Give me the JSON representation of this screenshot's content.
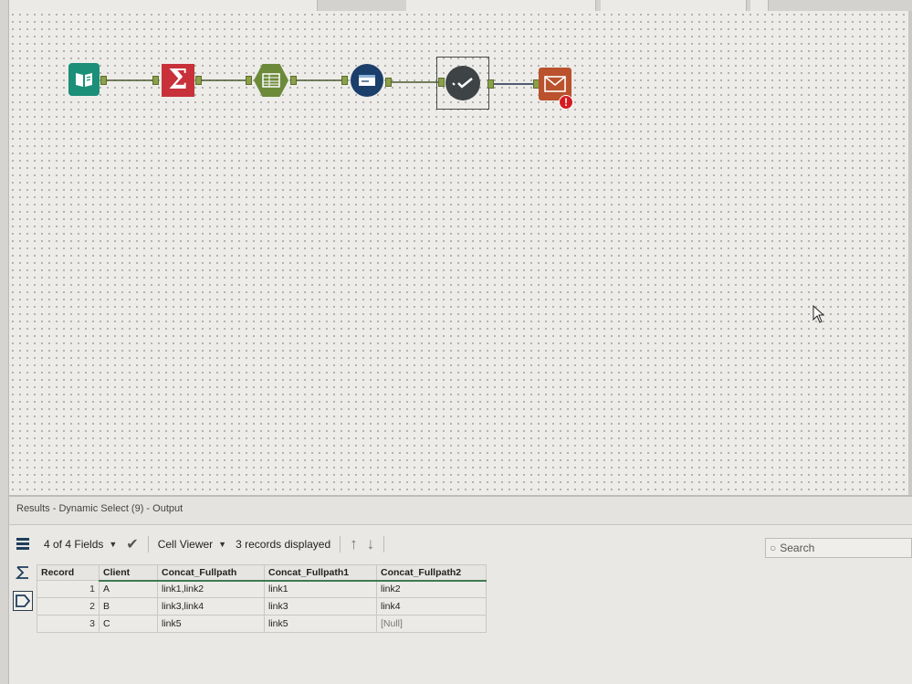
{
  "colors": {
    "accent_green": "#3f7a52",
    "summarize_red": "#c8313a",
    "input_teal": "#1b8f78",
    "error_red": "#d51a22"
  },
  "workflow": {
    "tools": [
      {
        "name": "input-data-tool",
        "icon": "book-icon"
      },
      {
        "name": "summarize-tool",
        "icon": "sigma-icon",
        "glyph": "Σ"
      },
      {
        "name": "crosstab-tool",
        "icon": "table-icon"
      },
      {
        "name": "formula-tool",
        "icon": "formula-window-icon"
      },
      {
        "name": "dynamic-select-tool",
        "icon": "check-icon",
        "selected": true
      },
      {
        "name": "email-tool",
        "icon": "envelope-icon",
        "error_badge": "!"
      }
    ]
  },
  "results": {
    "title": "Results - Dynamic Select (9) - Output",
    "toolbar": {
      "fields_label": "4 of 4 Fields",
      "viewer_label": "Cell Viewer",
      "records_label": "3 records displayed"
    },
    "search_placeholder": "Search",
    "columns": [
      "Record",
      "Client",
      "Concat_Fullpath",
      "Concat_Fullpath1",
      "Concat_Fullpath2"
    ],
    "rows": [
      [
        "1",
        "A",
        "link1,link2",
        "link1",
        "link2"
      ],
      [
        "2",
        "B",
        "link3,link4",
        "link3",
        "link4"
      ],
      [
        "3",
        "C",
        "link5",
        "link5",
        "[Null]"
      ]
    ]
  }
}
